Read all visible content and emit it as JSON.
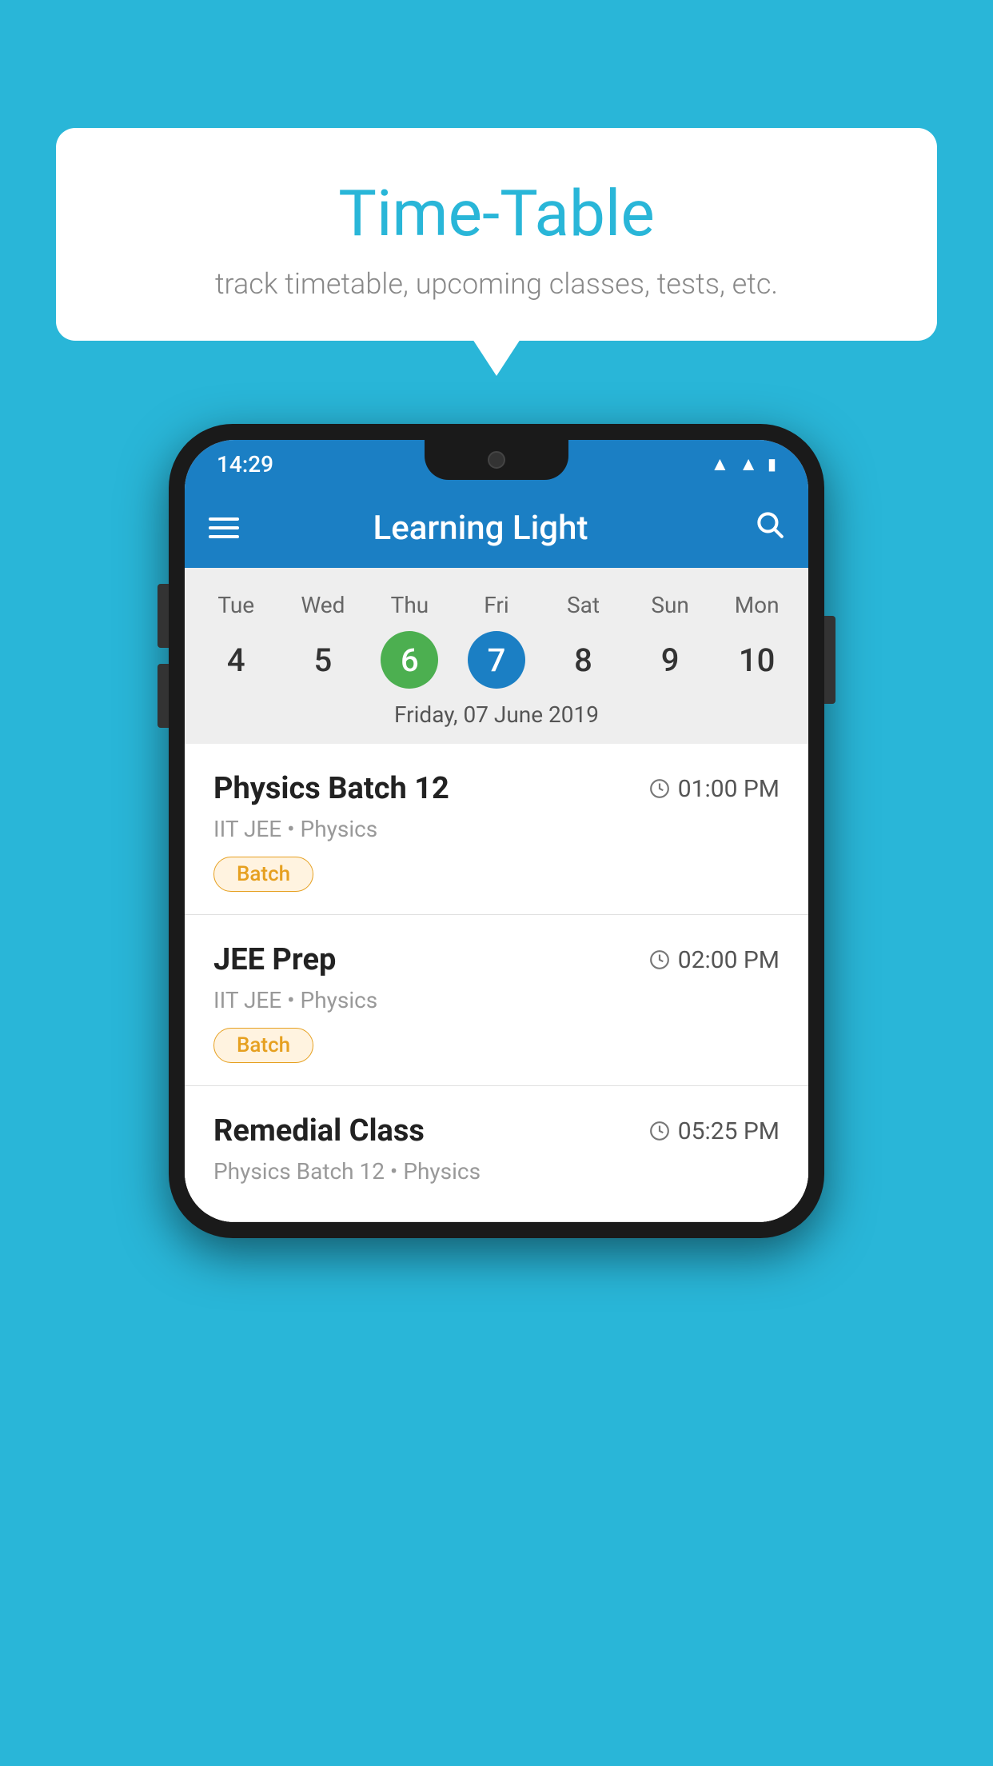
{
  "background_color": "#29b6d8",
  "tooltip": {
    "title": "Time-Table",
    "subtitle": "track timetable, upcoming classes, tests, etc."
  },
  "phone": {
    "status_bar": {
      "time": "14:29"
    },
    "app_bar": {
      "title": "Learning Light"
    },
    "calendar": {
      "days": [
        {
          "name": "Tue",
          "num": "4",
          "state": "normal"
        },
        {
          "name": "Wed",
          "num": "5",
          "state": "normal"
        },
        {
          "name": "Thu",
          "num": "6",
          "state": "today"
        },
        {
          "name": "Fri",
          "num": "7",
          "state": "selected"
        },
        {
          "name": "Sat",
          "num": "8",
          "state": "normal"
        },
        {
          "name": "Sun",
          "num": "9",
          "state": "normal"
        },
        {
          "name": "Mon",
          "num": "10",
          "state": "normal"
        }
      ],
      "selected_date_label": "Friday, 07 June 2019"
    },
    "schedule": [
      {
        "class_name": "Physics Batch 12",
        "time": "01:00 PM",
        "meta": "IIT JEE • Physics",
        "badge": "Batch"
      },
      {
        "class_name": "JEE Prep",
        "time": "02:00 PM",
        "meta": "IIT JEE • Physics",
        "badge": "Batch"
      },
      {
        "class_name": "Remedial Class",
        "time": "05:25 PM",
        "meta": "Physics Batch 12 • Physics",
        "badge": null
      }
    ]
  }
}
